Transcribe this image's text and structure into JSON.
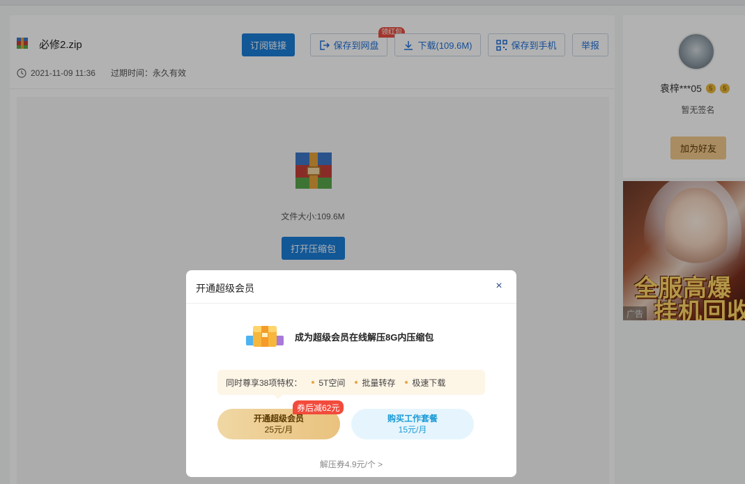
{
  "file": {
    "name": "必修2.zip",
    "date": "2021-11-09 11:36",
    "expiry": "过期时间：永久有效",
    "size_text": "文件大小:109.6M",
    "open_label": "打开压缩包"
  },
  "toolbar": {
    "subscribe": "订阅链接",
    "save_cloud": "保存到网盘",
    "save_cloud_badge": "领红包",
    "download": "下载(109.6M)",
    "save_phone": "保存到手机",
    "report": "举报"
  },
  "profile": {
    "username": "袁梓***05",
    "vip_badge": "5",
    "signature": "暂无签名",
    "add_friend": "加为好友"
  },
  "ad": {
    "line1": "全服高爆",
    "line2": "挂机回收",
    "tag": "广告"
  },
  "modal": {
    "title": "开通超级会员",
    "close": "×",
    "promo": "成为超级会员在线解压8G内压缩包",
    "benefits_label": "同时尊享38项特权：",
    "benefits": [
      "5T空间",
      "批量转存",
      "极速下载"
    ],
    "coupon_badge": "券后减62元",
    "plan1": {
      "name": "开通超级会员",
      "price": "25元/月"
    },
    "plan2": {
      "name": "购买工作套餐",
      "price": "15元/月"
    },
    "ticket_link": "解压券4.9元/个 >"
  },
  "colors": {
    "primary": "#1a7dd7",
    "gold": "#e9c27e",
    "red": "#f24b3c"
  }
}
